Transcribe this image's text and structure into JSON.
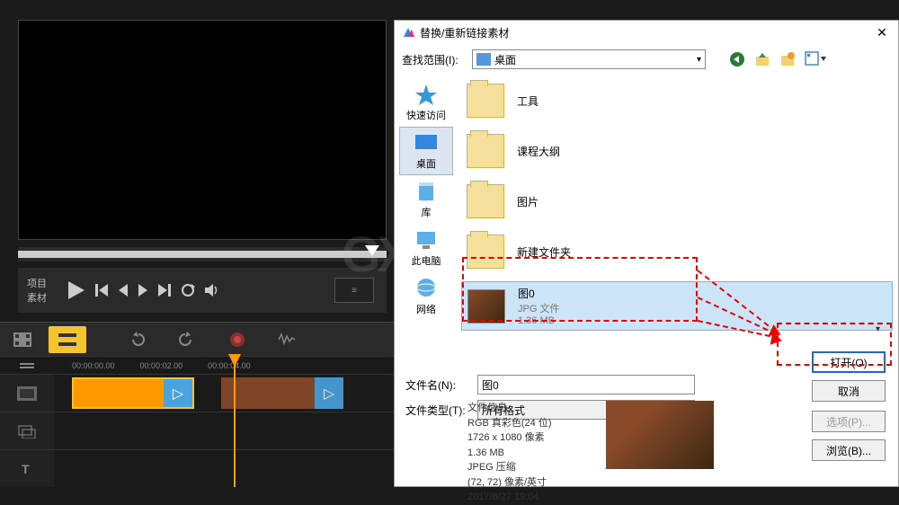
{
  "preview": {
    "project_label": "项目",
    "material_label": "素材",
    "timecode_display": "≡"
  },
  "timeline": {
    "timecodes": [
      "00:00:00.00",
      "00:00:02.00",
      "00:00:04.00"
    ]
  },
  "dialog": {
    "title": "替换/重新链接素材",
    "close": "✕",
    "lookup_label": "查找范围(I):",
    "lookup_value": "桌面",
    "sidebar": [
      {
        "label": "快速访问"
      },
      {
        "label": "桌面"
      },
      {
        "label": "库"
      },
      {
        "label": "此电脑"
      },
      {
        "label": "网络"
      }
    ],
    "files": [
      {
        "name": "工具",
        "type": "folder"
      },
      {
        "name": "课程大纲",
        "type": "folder"
      },
      {
        "name": "图片",
        "type": "folder"
      },
      {
        "name": "新建文件夹",
        "type": "folder"
      },
      {
        "name": "图0",
        "type": "image",
        "meta1": "JPG 文件",
        "meta2": "1.36 MB"
      }
    ],
    "filename_label": "文件名(N):",
    "filename_value": "图0",
    "filetype_label": "文件类型(T):",
    "filetype_value": "所有格式",
    "open_btn": "打开(O)",
    "cancel_btn": "取消",
    "options_btn": "选项(P)...",
    "browse_btn": "浏览(B)...",
    "file_info": {
      "title": "文件信息",
      "line1": "RGB 真彩色(24 位)",
      "line2": "1726 x 1080 像素",
      "line3": "1.36 MB",
      "line4": "JPEG 压缩",
      "line5": "(72, 72) 像素/英寸",
      "line6": "2017/8/27 19:04"
    }
  },
  "watermark": "GX"
}
